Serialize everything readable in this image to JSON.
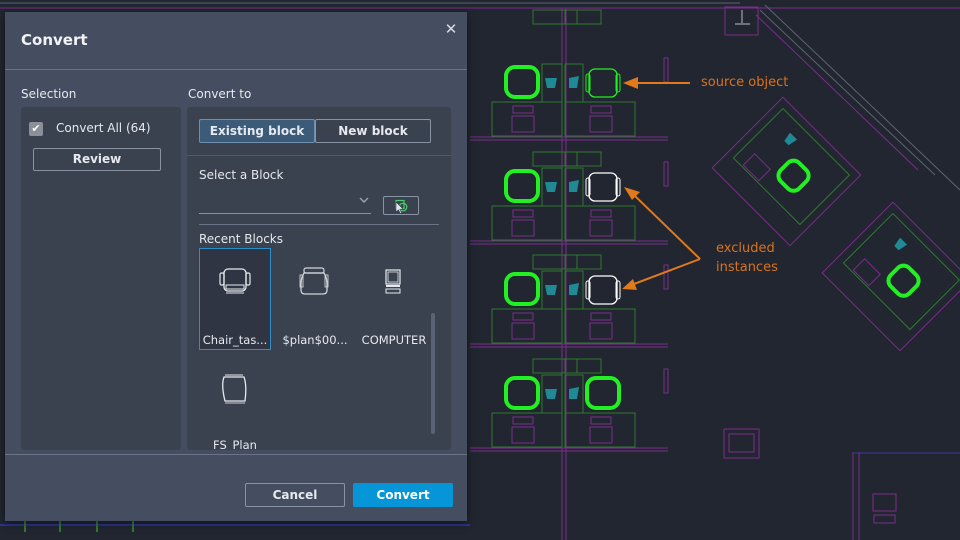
{
  "drawing": {
    "annotations": {
      "source_label": "source object",
      "excluded_label_line1": "excluded",
      "excluded_label_line2": "instances"
    },
    "colors": {
      "background": "#212630",
      "highlight_green": "#22f022",
      "partition_purple": "#7a2d8c",
      "furniture_green": "#2f7a2f",
      "cyan_phone": "#1f8a96",
      "annotation_orange": "#e07a1a",
      "excluded_white": "#ffffff"
    }
  },
  "dialog": {
    "title": "Convert",
    "close_icon": "close-icon",
    "selection": {
      "label": "Selection",
      "convert_all_label": "Convert All (64)",
      "convert_all_checked": true,
      "review_label": "Review"
    },
    "convert_to": {
      "label": "Convert to",
      "segments": [
        {
          "label": "Existing block",
          "active": true
        },
        {
          "label": "New block",
          "active": false
        }
      ],
      "select_block_label": "Select a Block",
      "select_block_value": "",
      "pick_icon": "select-object-icon",
      "recent_blocks_label": "Recent Blocks",
      "recent_blocks": [
        {
          "label": "Chair_tas...",
          "icon": "task-chair-icon",
          "selected": true
        },
        {
          "label": "$plan$00...",
          "icon": "armchair-icon",
          "selected": false
        },
        {
          "label": "COMPUTER",
          "icon": "computer-icon",
          "selected": false
        },
        {
          "label": "FS_Plan",
          "icon": "chair-plan-icon",
          "selected": false
        }
      ]
    },
    "footer": {
      "cancel_label": "Cancel",
      "convert_label": "Convert"
    },
    "accent_color": "#0696d7"
  }
}
